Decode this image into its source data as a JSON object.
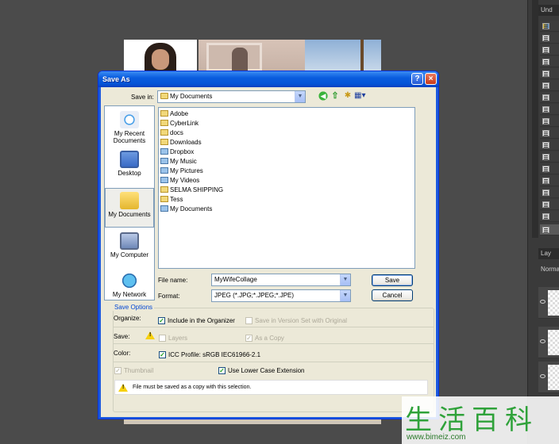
{
  "app": {
    "panels": {
      "history_tab": "Und",
      "layers_tab": "Lay",
      "blend_mode": "Norma"
    }
  },
  "dialog": {
    "title": "Save As",
    "help_label": "?",
    "close_label": "×",
    "save_in_label": "Save in:",
    "save_in_value": "My Documents",
    "places": [
      {
        "label": "My Recent Documents"
      },
      {
        "label": "Desktop"
      },
      {
        "label": "My Documents"
      },
      {
        "label": "My Computer"
      },
      {
        "label": "My Network"
      }
    ],
    "files": [
      "Adobe",
      "CyberLink",
      "docs",
      "Downloads",
      "Dropbox",
      "My Music",
      "My Pictures",
      "My Videos",
      "SELMA SHIPPING",
      "Tess",
      "My Documents"
    ],
    "file_name_label": "File name:",
    "file_name_value": "MyWifeCollage",
    "format_label": "Format:",
    "format_value": "JPEG (*.JPG;*.JPEG;*.JPE)",
    "save_button": "Save",
    "cancel_button": "Cancel",
    "options": {
      "group_title": "Save Options",
      "organize_label": "Organize:",
      "include_organizer": "Include in the Organizer",
      "version_set": "Save in Version Set with Original",
      "save_label": "Save:",
      "layers": "Layers",
      "as_copy": "As a Copy",
      "color_label": "Color:",
      "icc_profile": "ICC Profile:  sRGB IEC61966-2.1",
      "thumbnail": "Thumbnail",
      "lower_case": "Use Lower Case Extension",
      "warning_message": "File must be saved as a copy with this selection."
    }
  },
  "watermark": {
    "chars": "生活百科",
    "url": "www.bimeiz.com"
  }
}
